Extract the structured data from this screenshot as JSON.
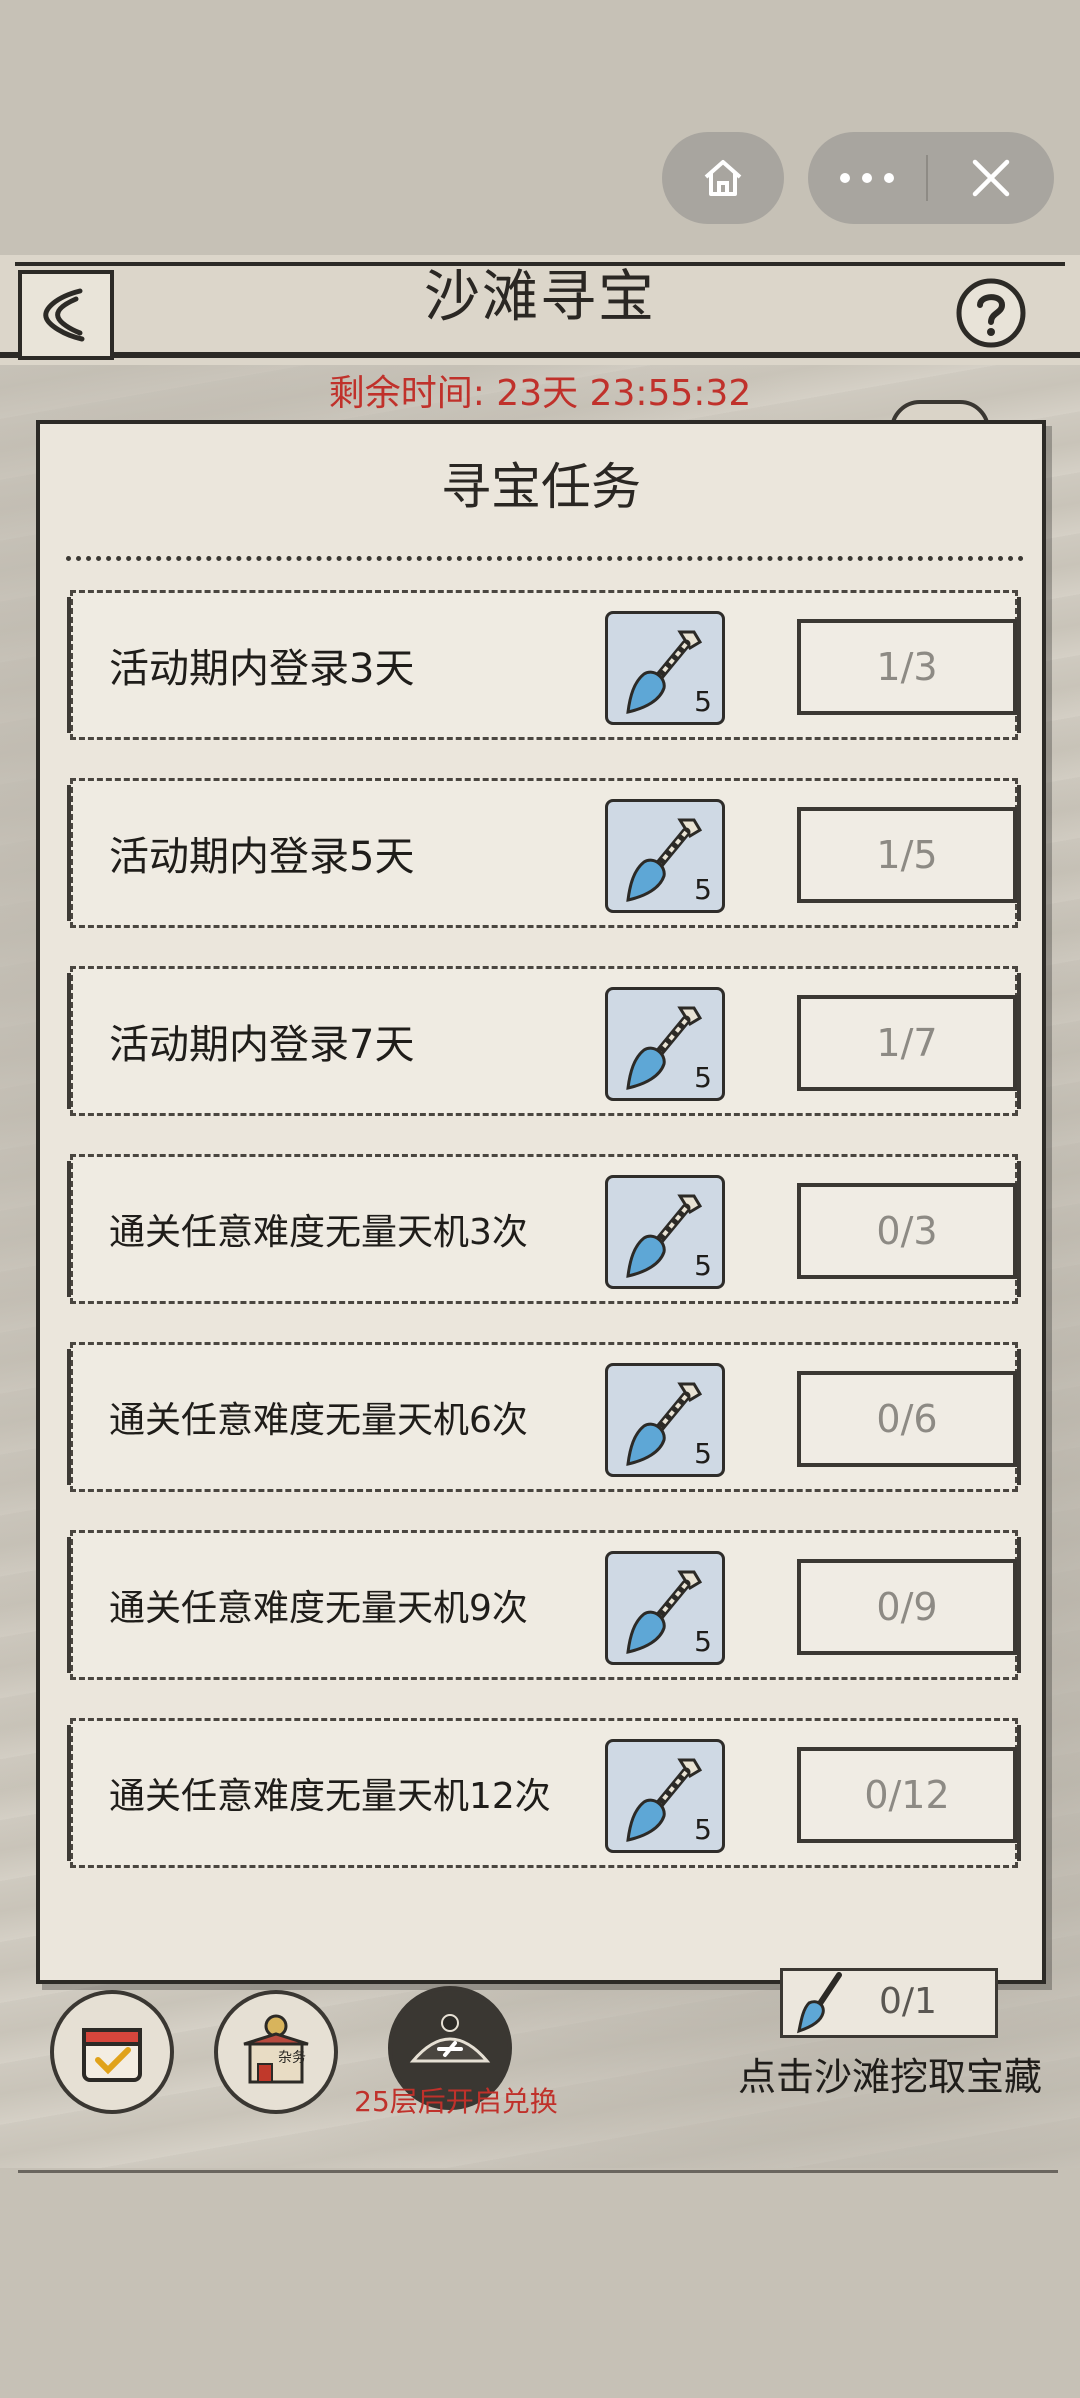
{
  "header": {
    "title": "沙滩寻宝"
  },
  "timer": {
    "text": "剩余时间: 23天 23:55:32"
  },
  "dialog": {
    "title": "寻宝任务",
    "tasks": [
      {
        "label": "活动期内登录3天",
        "reward_count": "5",
        "progress": "1/3"
      },
      {
        "label": "活动期内登录5天",
        "reward_count": "5",
        "progress": "1/5"
      },
      {
        "label": "活动期内登录7天",
        "reward_count": "5",
        "progress": "1/7"
      },
      {
        "label": "通关任意难度无量天机3次",
        "reward_count": "5",
        "progress": "0/3"
      },
      {
        "label": "通关任意难度无量天机6次",
        "reward_count": "5",
        "progress": "0/6"
      },
      {
        "label": "通关任意难度无量天机9次",
        "reward_count": "5",
        "progress": "0/9"
      },
      {
        "label": "通关任意难度无量天机12次",
        "reward_count": "5",
        "progress": "0/12"
      }
    ]
  },
  "bottom": {
    "exchange_caption": "25层后开启兑换",
    "shovel_progress": "0/1",
    "dig_hint": "点击沙滩挖取宝藏",
    "shop_label": "杂务"
  },
  "colors": {
    "timer_red": "#c0312b",
    "shovel_blue": "#5ea7d6",
    "paper": "#ebe6dc",
    "ink": "#2c2a26"
  }
}
